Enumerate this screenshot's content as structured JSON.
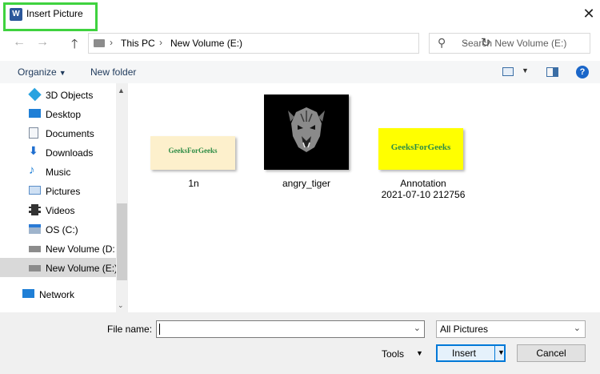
{
  "window": {
    "title": "Insert Picture",
    "app_icon_letter": "W",
    "close_glyph": "✕"
  },
  "address": {
    "back_glyph": "←",
    "forward_glyph": "→",
    "up_glyph": "🡑",
    "path": [
      "This PC",
      "New Volume (E:)"
    ],
    "separator": "›",
    "dropdown_glyph": "⌄",
    "refresh_glyph": "↻"
  },
  "search": {
    "placeholder": "Search New Volume (E:)",
    "icon_glyph": "⚲"
  },
  "toolbar": {
    "organize_label": "Organize",
    "caret": "▼",
    "new_folder_label": "New folder",
    "help_glyph": "?"
  },
  "sidebar": {
    "items": [
      {
        "label": "3D Objects",
        "icon": "cube-icon",
        "color": "#29a3e0"
      },
      {
        "label": "Desktop",
        "icon": "desktop-icon",
        "color": "#1f7fd6"
      },
      {
        "label": "Documents",
        "icon": "documents-icon",
        "color": "#7c8a9c"
      },
      {
        "label": "Downloads",
        "icon": "download-icon",
        "color": "#1f6fd0"
      },
      {
        "label": "Music",
        "icon": "music-icon",
        "color": "#1f7fd6"
      },
      {
        "label": "Pictures",
        "icon": "pictures-icon",
        "color": "#5b8ec8"
      },
      {
        "label": "Videos",
        "icon": "videos-icon",
        "color": "#333333"
      },
      {
        "label": "OS (C:)",
        "icon": "drive-icon",
        "color": "#6b8fb8"
      },
      {
        "label": "New Volume (D:",
        "icon": "drive-icon",
        "color": "#8c8c8c"
      },
      {
        "label": "New Volume (E:)",
        "icon": "drive-icon",
        "color": "#8c8c8c",
        "selected": true
      },
      {
        "label": "Network",
        "icon": "network-icon",
        "color": "#1f7fd6"
      }
    ],
    "scroll_up_glyph": "▲",
    "scroll_down_glyph": "⌄"
  },
  "files": [
    {
      "name": "1n",
      "thumb_text": "GeeksForGeeks",
      "thumb": "gfg-cream"
    },
    {
      "name": "angry_tiger",
      "thumb": "tiger-dark"
    },
    {
      "name_line1": "Annotation",
      "name_line2": "2021-07-10 212756",
      "thumb_text": "GeeksForGeeks",
      "thumb": "gfg-yellow"
    }
  ],
  "bottom": {
    "file_name_label": "File name:",
    "file_name_value": "",
    "filter_value": "All Pictures",
    "tools_label": "Tools",
    "insert_label": "Insert",
    "cancel_label": "Cancel",
    "caret": "▼",
    "select_caret": "⌄"
  }
}
